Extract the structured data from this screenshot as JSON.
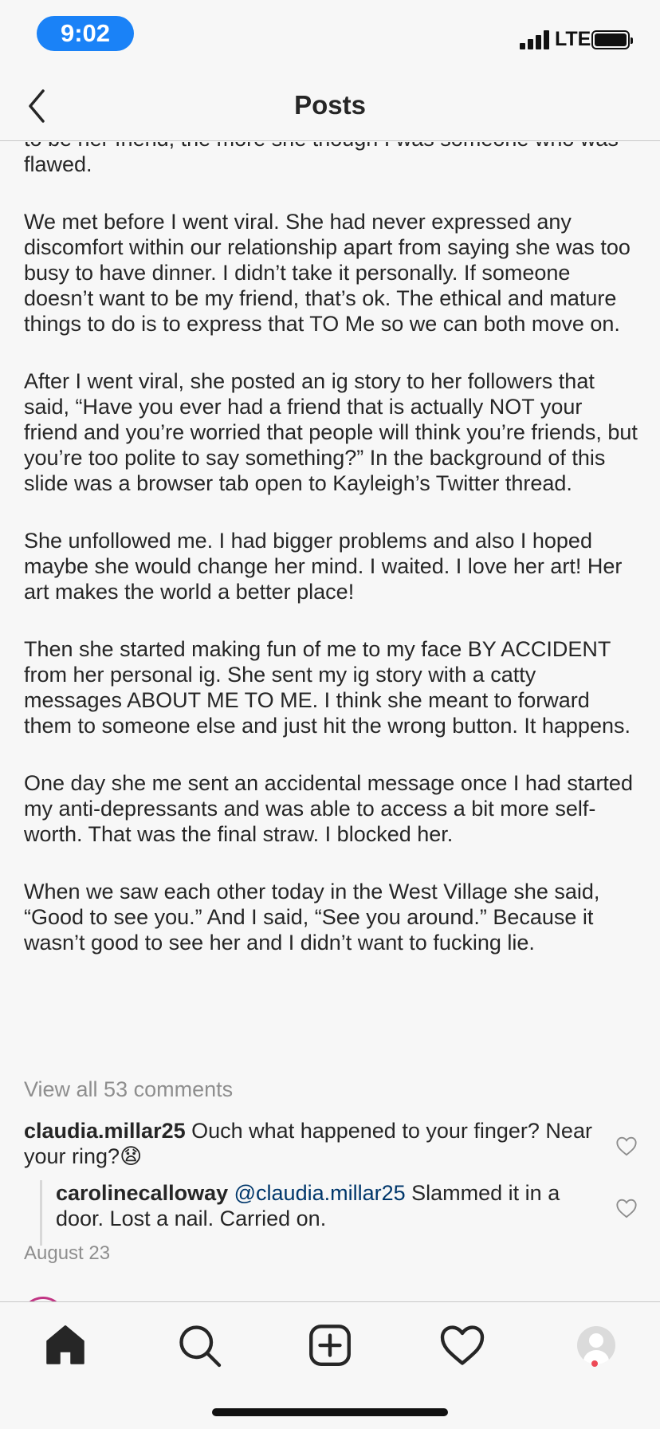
{
  "status_bar": {
    "time": "9:02",
    "network": "LTE"
  },
  "header": {
    "title": "Posts"
  },
  "caption": {
    "paragraphs": [
      "to be her friend, the more she though I was someone who was flawed.",
      "We met before I went viral. She had never expressed any discomfort within our relationship apart from saying she was too busy to have dinner. I didn’t take it personally. If someone doesn’t want to be my friend, that’s ok. The ethical and mature things to do is to express that TO Me so we can both move on.",
      "After I went viral, she posted an ig story to her followers that said, “Have you ever had a friend that is actually NOT your friend and you’re worried that people will think you’re friends, but you’re too polite to say something?” In the background of this slide was a browser tab open to Kayleigh’s Twitter thread.",
      "She unfollowed me. I had bigger problems and also I hoped maybe she would change her mind. I waited. I love her art! Her art makes the world a better place!",
      "Then she started making fun of me to my face BY ACCIDENT from her personal ig. She sent my ig story with a catty messages ABOUT ME TO ME. I think she meant to forward them to someone else and just hit the wrong button. It happens.",
      "One day she me sent an accidental message once I had started my anti-depressants and was able to access a bit more self-worth. That was the final straw. I blocked her.",
      "When we saw each other today in the West Village she said, “Good to see you.” And I said, “See you around.” Because it wasn’t good to see her and I didn’t want to fucking lie."
    ]
  },
  "comments": {
    "view_all_label": "View all 53 comments",
    "items": [
      {
        "username": "claudia.millar25",
        "text": "Ouch what happened to your finger? Near your ring?😧"
      },
      {
        "username": "carolinecalloway",
        "mention": "@claudia.millar25",
        "text": "Slammed it in a door. Lost a nail. Carried on."
      }
    ]
  },
  "post_date": "August 23",
  "tab_bar": {
    "icons": [
      "home-icon",
      "search-icon",
      "add-post-icon",
      "heart-icon",
      "profile-icon"
    ],
    "notification_color": "#ed4956"
  },
  "colors": {
    "time_pill": "#1a82f7",
    "mention": "#00376b",
    "muted": "#8e8e8e"
  }
}
